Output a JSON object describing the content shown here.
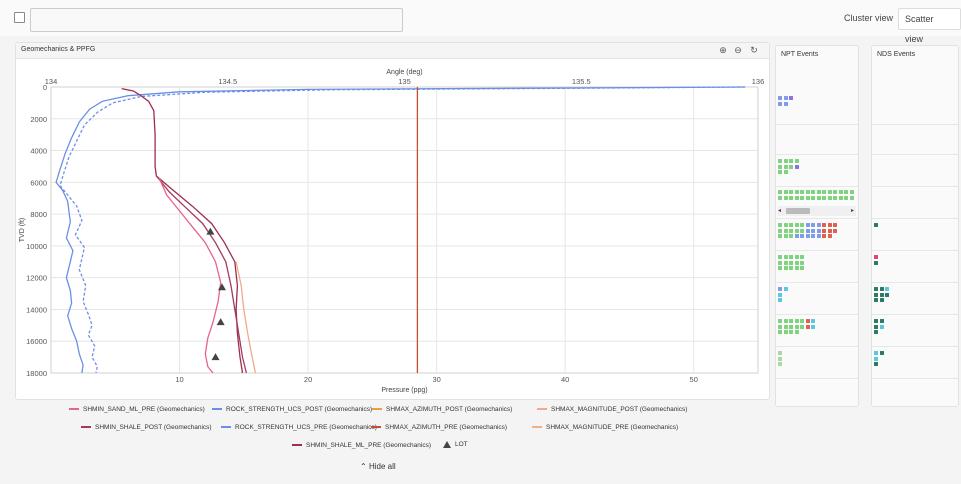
{
  "topbar": {
    "cluster_label": "Cluster view",
    "scatter_label": "Scatter view"
  },
  "panel": {
    "title": "Geomechanics & PPFG"
  },
  "npt": {
    "title": "NPT Events"
  },
  "nds": {
    "title": "NDS Events"
  },
  "legend": {
    "items": [
      "SHMIN_SAND_ML_PRE (Geomechanics)",
      "ROCK_STRENGTH_UCS_POST (Geomechanics)",
      "SHMAX_AZIMUTH_POST (Geomechanics)",
      "SHMAX_MAGNITUDE_POST (Geomechanics)",
      "SHMIN_SHALE_POST (Geomechanics)",
      "ROCK_STRENGTH_UCS_PRE (Geomechanics)",
      "SHMAX_AZIMUTH_PRE (Geomechanics)",
      "SHMAX_MAGNITUDE_PRE (Geomechanics)",
      "SHMIN_SHALE_ML_PRE (Geomechanics)",
      "LOT"
    ],
    "hide_all": "Hide all"
  },
  "colors": {
    "shmin_sand_ml_pre": "#e8638a",
    "rock_strength_ucs_post": "#6b8fe8",
    "shmax_azimuth_post": "#e8a23a",
    "shmax_magnitude_post": "#f2a98a",
    "shmin_shale_post": "#a63a5a",
    "rock_strength_ucs_pre": "#6b8fe8",
    "shmax_azimuth_pre": "#c0502f",
    "shmax_magnitude_pre": "#f0b080",
    "shmin_shale_ml_pre": "#9b2f4e",
    "lot": "#444444"
  },
  "chart_data": {
    "type": "line",
    "ylabel": "TVD (ft)",
    "xlabel": "Pressure (ppg)",
    "x2label": "Angle (deg)",
    "y_ticks": [
      "0",
      "2000",
      "4000",
      "6000",
      "8000",
      "10000",
      "12000",
      "14000",
      "16000",
      "18000"
    ],
    "x_ticks": [
      "10",
      "20",
      "30",
      "40",
      "50"
    ],
    "x2_ticks": [
      "134",
      "134.5",
      "135",
      "135.5",
      "136"
    ],
    "ylim": [
      0,
      18000
    ],
    "xlim": [
      0,
      55
    ],
    "x2lim": [
      134,
      136
    ],
    "series": [
      {
        "name": "ROCK_STRENGTH_UCS_POST (Geomechanics)",
        "axis": "bottom",
        "points": [
          [
            54,
            0
          ],
          [
            40,
            60
          ],
          [
            20,
            150
          ],
          [
            10,
            300
          ],
          [
            6,
            550
          ],
          [
            4,
            900
          ],
          [
            3,
            1400
          ],
          [
            2.2,
            2200
          ],
          [
            1.6,
            3200
          ],
          [
            1.1,
            4200
          ],
          [
            0.7,
            5200
          ],
          [
            0.4,
            6000
          ],
          [
            0.9,
            6500
          ],
          [
            1.3,
            7200
          ],
          [
            1.5,
            8500
          ],
          [
            1.2,
            9500
          ],
          [
            1.7,
            10300
          ],
          [
            1.5,
            11000
          ],
          [
            1.2,
            12000
          ],
          [
            1.5,
            12800
          ],
          [
            1.6,
            13600
          ],
          [
            1.3,
            14400
          ],
          [
            1.6,
            15200
          ],
          [
            2.0,
            16000
          ],
          [
            2.2,
            16800
          ],
          [
            2.5,
            17500
          ],
          [
            2.4,
            18000
          ]
        ]
      },
      {
        "name": "ROCK_STRENGTH_UCS_PRE (Geomechanics)",
        "axis": "bottom",
        "points": [
          [
            54,
            0
          ],
          [
            40,
            80
          ],
          [
            22,
            170
          ],
          [
            12,
            330
          ],
          [
            7,
            600
          ],
          [
            4.8,
            1000
          ],
          [
            3.6,
            1600
          ],
          [
            2.6,
            2400
          ],
          [
            2.0,
            3400
          ],
          [
            1.4,
            4400
          ],
          [
            1.0,
            5400
          ],
          [
            0.7,
            6200
          ],
          [
            1.3,
            6800
          ],
          [
            2.0,
            7500
          ],
          [
            2.4,
            8400
          ],
          [
            1.9,
            9300
          ],
          [
            2.6,
            10100
          ],
          [
            2.4,
            10800
          ],
          [
            2.2,
            11500
          ],
          [
            2.7,
            12500
          ],
          [
            2.5,
            13500
          ],
          [
            2.9,
            14300
          ],
          [
            3.2,
            15000
          ],
          [
            2.9,
            15600
          ],
          [
            3.4,
            16300
          ],
          [
            3.2,
            17000
          ],
          [
            3.6,
            17600
          ],
          [
            3.5,
            18000
          ]
        ]
      },
      {
        "name": "SHMIN_SHALE_ML_PRE (Geomechanics)",
        "axis": "bottom",
        "points": [
          [
            5.5,
            100
          ],
          [
            6.4,
            250
          ],
          [
            6.9,
            500
          ],
          [
            7.6,
            900
          ],
          [
            8.0,
            1500
          ],
          [
            8.1,
            3000
          ],
          [
            8.1,
            5000
          ],
          [
            8.2,
            5600
          ],
          [
            9.5,
            6500
          ],
          [
            11,
            7500
          ],
          [
            12.5,
            8600
          ],
          [
            13.5,
            9800
          ],
          [
            14.3,
            11000
          ],
          [
            14.5,
            12500
          ],
          [
            14.4,
            14000
          ],
          [
            14.5,
            15500
          ],
          [
            14.7,
            17000
          ],
          [
            14.9,
            18000
          ]
        ]
      },
      {
        "name": "SHMIN_SHALE_POST (Geomechanics)",
        "axis": "bottom",
        "points": [
          [
            8.2,
            5600
          ],
          [
            9.2,
            6600
          ],
          [
            10.5,
            7600
          ],
          [
            11.8,
            8600
          ],
          [
            12.8,
            9800
          ],
          [
            13.6,
            11000
          ],
          [
            14.0,
            12500
          ],
          [
            14.3,
            14000
          ],
          [
            14.6,
            15500
          ],
          [
            14.9,
            17000
          ],
          [
            15.2,
            18000
          ]
        ]
      },
      {
        "name": "SHMIN_SAND_ML_PRE (Geomechanics)",
        "axis": "bottom",
        "points": [
          [
            8.4,
            5700
          ],
          [
            9.0,
            6800
          ],
          [
            10.0,
            7800
          ],
          [
            11.0,
            8800
          ],
          [
            12.0,
            9800
          ],
          [
            12.8,
            11000
          ],
          [
            13.2,
            12300
          ],
          [
            13.0,
            13500
          ],
          [
            12.6,
            14800
          ],
          [
            12.2,
            15800
          ],
          [
            12.0,
            16800
          ],
          [
            12.2,
            17600
          ],
          [
            12.6,
            18000
          ]
        ]
      },
      {
        "name": "SHMAX_MAGNITUDE_POST (Geomechanics)",
        "axis": "bottom",
        "points": [
          [
            14.4,
            11000
          ],
          [
            14.8,
            12500
          ],
          [
            15.0,
            14000
          ],
          [
            15.3,
            15500
          ],
          [
            15.6,
            16800
          ],
          [
            15.9,
            18000
          ]
        ]
      },
      {
        "name": "SHMAX_AZIMUTH_POST (Geomechanics)",
        "axis": "bottom",
        "points": [
          [
            28.5,
            0
          ],
          [
            28.5,
            18000
          ]
        ]
      }
    ],
    "lot": [
      [
        12.4,
        9100
      ],
      [
        13.3,
        12600
      ],
      [
        13.2,
        14800
      ],
      [
        12.8,
        17000
      ]
    ]
  }
}
